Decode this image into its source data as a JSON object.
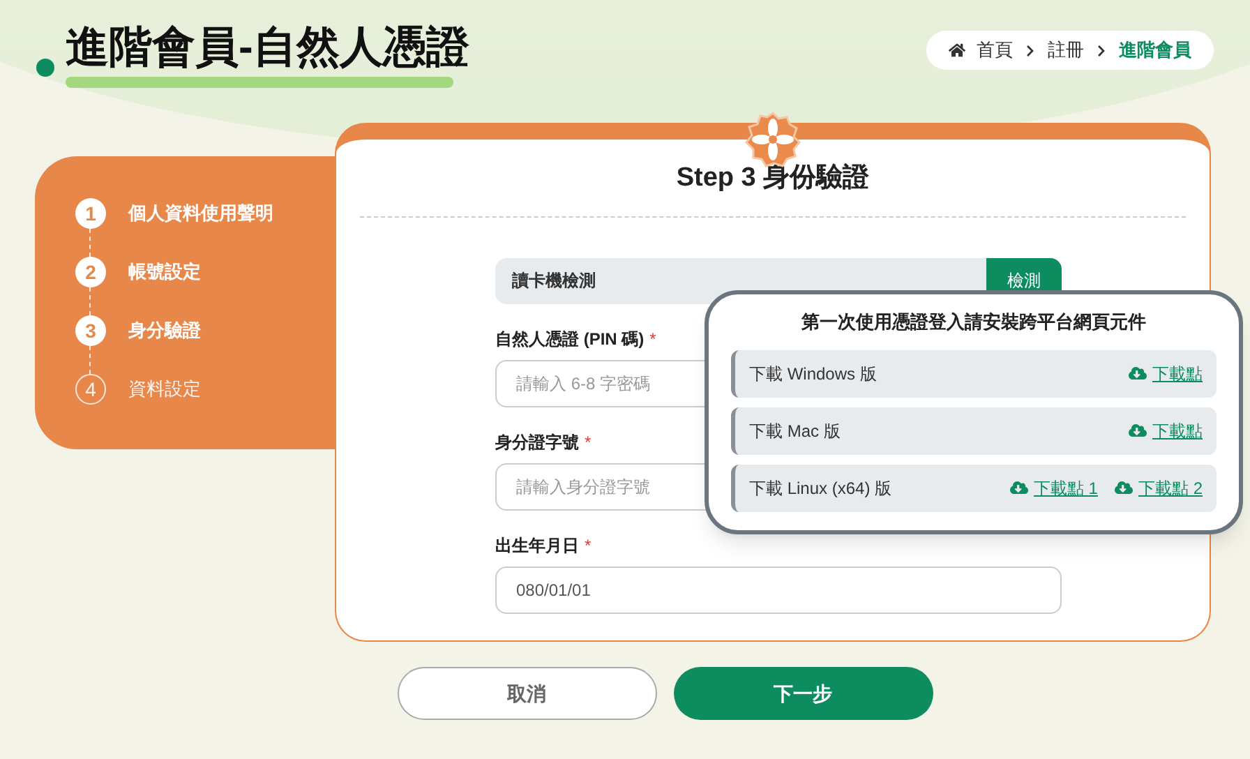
{
  "page_title": "進階會員-自然人憑證",
  "breadcrumb": [
    {
      "label": "首頁",
      "selected": false
    },
    {
      "label": "註冊",
      "selected": false
    },
    {
      "label": "進階會員",
      "selected": true
    }
  ],
  "steps": [
    {
      "number": "1",
      "label": "個人資料使用聲明",
      "completed": true
    },
    {
      "number": "2",
      "label": "帳號設定",
      "completed": true
    },
    {
      "number": "3",
      "label": "身分驗證",
      "completed": true
    },
    {
      "number": "4",
      "label": "資料設定",
      "completed": false
    }
  ],
  "form": {
    "title": "Step 3 身份驗證",
    "card_reader": {
      "label": "讀卡機檢測",
      "button": "檢測"
    },
    "fields": [
      {
        "label": "自然人憑證 (PIN 碼)",
        "required": true,
        "placeholder": "請輸入 6-8 字密碼"
      },
      {
        "label": "身分證字號",
        "required": true,
        "placeholder": "請輸入身分證字號"
      },
      {
        "label": "出生年月日",
        "required": true,
        "value": "080/01/01"
      }
    ],
    "required_mark": "*"
  },
  "popup": {
    "title": "第一次使用憑證登入請安裝跨平台網頁元件",
    "downloads": [
      {
        "label": "下載 Windows 版",
        "links": [
          "下載點"
        ]
      },
      {
        "label": "下載 Mac 版",
        "links": [
          "下載點"
        ]
      },
      {
        "label": "下載 Linux (x64) 版",
        "links": [
          "下載點 1",
          "下載點 2"
        ]
      }
    ]
  },
  "buttons": [
    {
      "label": "取消",
      "kind": "secondary"
    },
    {
      "label": "下一步",
      "kind": "primary"
    }
  ]
}
